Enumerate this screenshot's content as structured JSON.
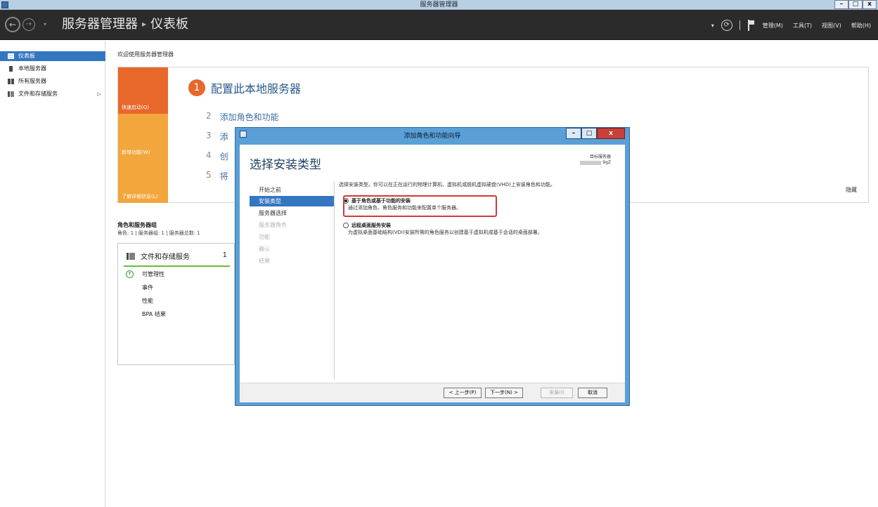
{
  "window": {
    "title": "服务器管理器",
    "buttons": {
      "minimize": "–",
      "maximize": "□",
      "close": "x"
    }
  },
  "header": {
    "breadcrumb_app": "服务器管理器",
    "breadcrumb_sep": "▸",
    "breadcrumb_page": "仪表板",
    "menus": {
      "manage": "管理(M)",
      "tools": "工具(T)",
      "view": "视图(V)",
      "help": "帮助(H)"
    },
    "refresh_glyph": "⟳",
    "dropdown_glyph": "▾"
  },
  "sidebar": {
    "items": [
      {
        "label": "仪表板",
        "icon": "dashboard-icon",
        "active": true
      },
      {
        "label": "本地服务器",
        "icon": "server-icon"
      },
      {
        "label": "所有服务器",
        "icon": "servers-icon"
      },
      {
        "label": "文件和存储服务",
        "icon": "storage-icon",
        "arrow": "▷"
      }
    ]
  },
  "main": {
    "welcome": "欢迎使用服务器管理器",
    "tiles": {
      "quick_start": "快速启动(Q)",
      "whats_new": "新增功能(W)",
      "learn_more": "了解详细信息(L)"
    },
    "steps": [
      {
        "num": "1",
        "text": "配置此本地服务器"
      },
      {
        "num": "2",
        "text": "添加角色和功能"
      },
      {
        "num": "3",
        "text": "添"
      },
      {
        "num": "4",
        "text": "创"
      },
      {
        "num": "5",
        "text": "将"
      }
    ],
    "hide": "隐藏",
    "roles_title": "角色和服务器组",
    "roles_sub": "角色: 1 | 服务器组: 1 | 服务器总数: 1",
    "role_card": {
      "title": "文件和存储服务",
      "count": "1",
      "rows": [
        "可管理性",
        "事件",
        "性能",
        "BPA 结果"
      ],
      "ok_glyph": "↑"
    }
  },
  "wizard": {
    "title": "添加角色和功能向导",
    "buttons": {
      "minimize": "–",
      "maximize": "□",
      "close": "x"
    },
    "heading": "选择安装类型",
    "target_label": "目标服务器",
    "target_value": "9gZ",
    "nav": [
      {
        "label": "开始之前",
        "state": "normal"
      },
      {
        "label": "安装类型",
        "state": "active"
      },
      {
        "label": "服务器选择",
        "state": "normal"
      },
      {
        "label": "服务器角色",
        "state": "disabled"
      },
      {
        "label": "功能",
        "state": "disabled"
      },
      {
        "label": "确认",
        "state": "disabled"
      },
      {
        "label": "结果",
        "state": "disabled"
      }
    ],
    "description": "选择安装类型。你可以在正在运行的物理计算机、虚拟机或脱机虚拟硬盘(VHD)上安装角色和功能。",
    "options": [
      {
        "label": "基于角色或基于功能的安装",
        "sub": "通过添加角色、角色服务和功能来配置单个服务器。",
        "checked": true
      },
      {
        "label": "远程桌面服务安装",
        "sub": "为虚拟桌面基础结构(VDI)安装所需的角色服务以创建基于虚拟机或基于会话的桌面部署。",
        "checked": false
      }
    ],
    "footer": {
      "prev": "< 上一步(P)",
      "next": "下一步(N) >",
      "install": "安装(I)",
      "cancel": "取消"
    }
  },
  "colors": {
    "header_bg": "#2b2b2b",
    "accent_blue": "#3377c1",
    "tile_orange": "#e8672b",
    "tile_amber": "#f2a63b",
    "highlight_red": "#d03a3a"
  }
}
